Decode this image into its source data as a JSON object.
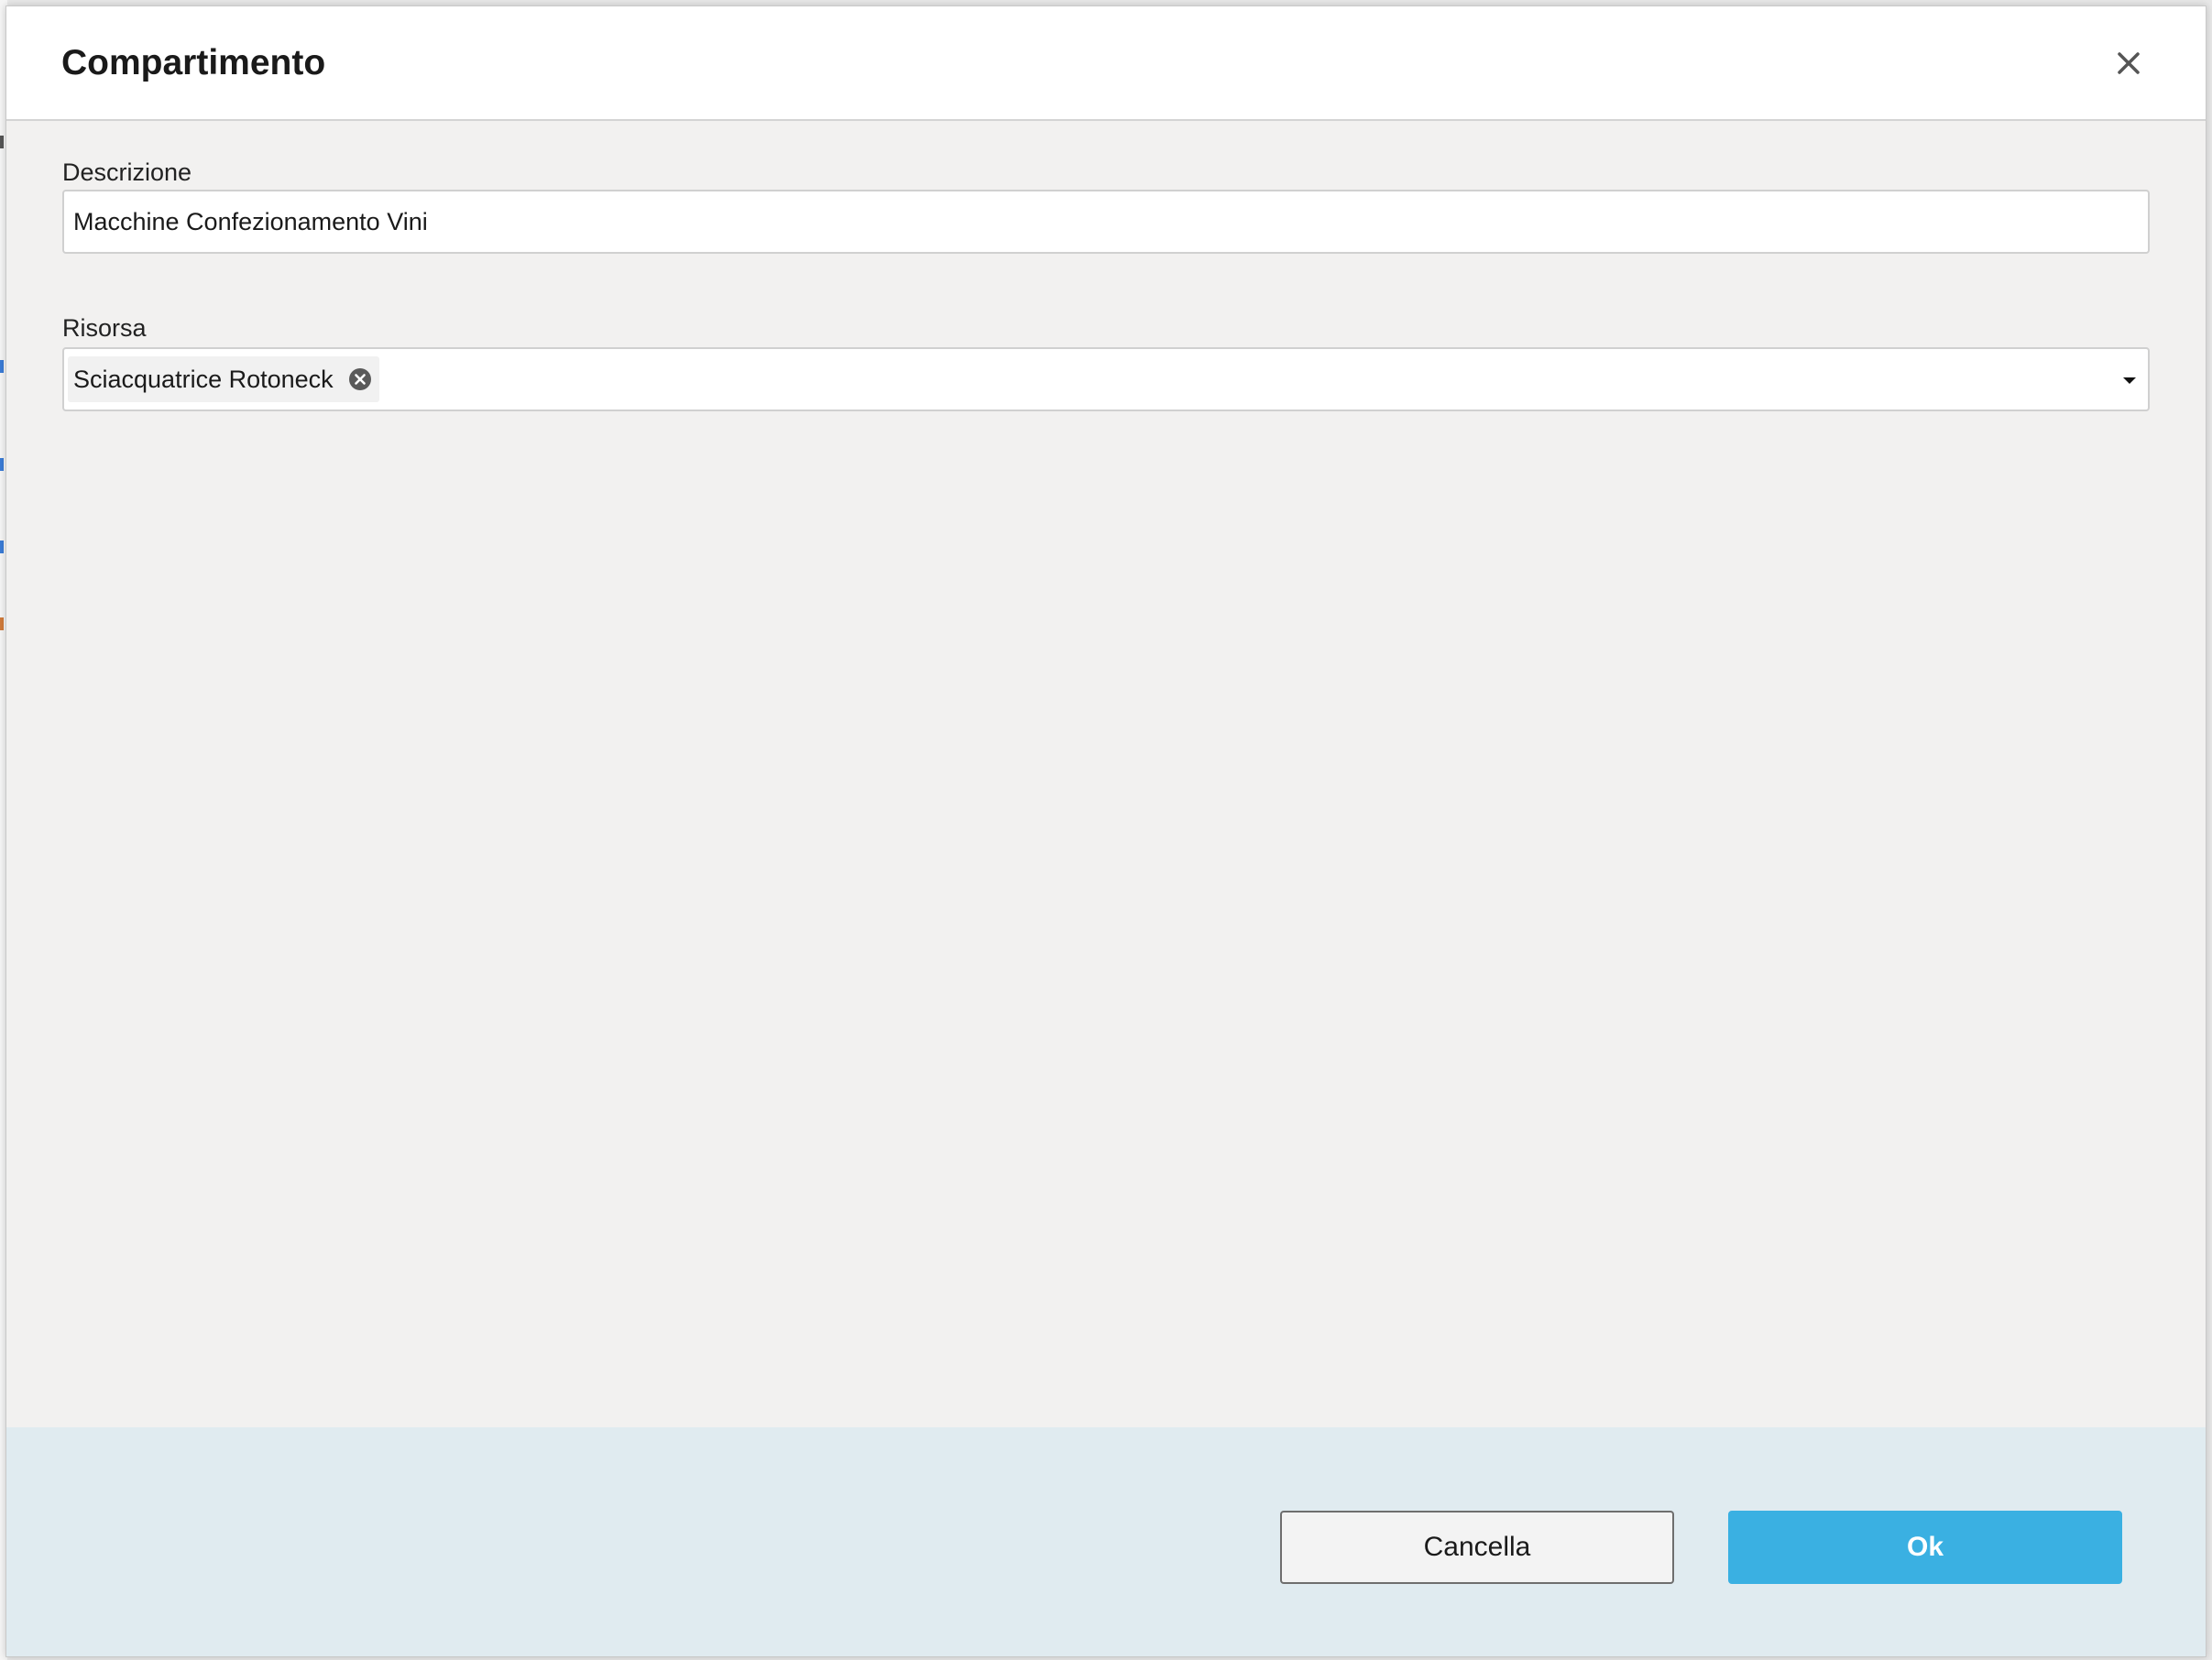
{
  "dialog": {
    "title": "Compartimento",
    "close_icon": "close-icon"
  },
  "form": {
    "descrizione": {
      "label": "Descrizione",
      "value": "Macchine Confezionamento Vini"
    },
    "risorsa": {
      "label": "Risorsa",
      "selected_tags": [
        "Sciacquatrice Rotoneck"
      ],
      "remove_icon": "remove-tag-icon",
      "dropdown_icon": "caret-down-icon"
    }
  },
  "footer": {
    "cancel_label": "Cancella",
    "ok_label": "Ok"
  },
  "colors": {
    "primary": "#3ab0e2",
    "footer_bg": "#e0ebf0",
    "body_bg": "#f2f1f0"
  }
}
